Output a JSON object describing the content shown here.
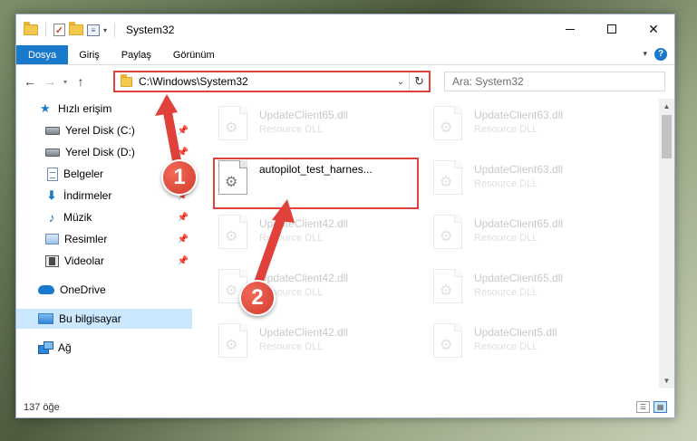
{
  "window": {
    "title": "System32",
    "quick_access_icons": [
      "folder-icon",
      "properties-check-icon",
      "new-folder-icon",
      "customize-icon"
    ]
  },
  "ribbon": {
    "tabs": [
      {
        "label": "Dosya",
        "active": true
      },
      {
        "label": "Giriş"
      },
      {
        "label": "Paylaş"
      },
      {
        "label": "Görünüm"
      }
    ],
    "accent": "#1979ca"
  },
  "address": {
    "path": "C:\\Windows\\System32",
    "search_placeholder": "Ara: System32"
  },
  "nav": {
    "items": [
      {
        "label": "Hızlı erişim",
        "icon": "star-icon"
      },
      {
        "label": "Yerel Disk (C:)",
        "icon": "disk-icon",
        "pinned": true
      },
      {
        "label": "Yerel Disk (D:)",
        "icon": "disk-icon",
        "pinned": true
      },
      {
        "label": "Belgeler",
        "icon": "documents-icon",
        "pinned": true
      },
      {
        "label": "İndirmeler",
        "icon": "downloads-icon",
        "pinned": true
      },
      {
        "label": "Müzik",
        "icon": "music-icon",
        "pinned": true
      },
      {
        "label": "Resimler",
        "icon": "pictures-icon",
        "pinned": true
      },
      {
        "label": "Videolar",
        "icon": "videos-icon",
        "pinned": true
      },
      {
        "label": "OneDrive",
        "icon": "onedrive-icon"
      },
      {
        "label": "Bu bilgisayar",
        "icon": "this-pc-icon",
        "selected": true
      },
      {
        "label": "Ağ",
        "icon": "network-icon"
      }
    ]
  },
  "files": [
    {
      "name": "UpdateClient65.dll",
      "type": "Resource DLL"
    },
    {
      "name": "UpdateClient63.dll",
      "type": "Resource DLL"
    },
    {
      "name": "autopilot_test_harnes...",
      "type": ""
    },
    {
      "name": "UpdateClient63.dll",
      "type": "Resource DLL"
    },
    {
      "name": "UpdateClient42.dll",
      "type": "Resource DLL"
    },
    {
      "name": "UpdateClient65.dll",
      "type": "Resource DLL"
    },
    {
      "name": "UpdateClient42.dll",
      "type": "Resource DLL"
    },
    {
      "name": "UpdateClient65.dll",
      "type": "Resource DLL"
    },
    {
      "name": "UpdateClient42.dll",
      "type": "Resource DLL"
    },
    {
      "name": "UpdateClient5.dll",
      "type": "Resource DLL"
    }
  ],
  "status": {
    "count": "137 öğe"
  },
  "annotations": {
    "step1": "1",
    "step2": "2",
    "color": "#e0413a"
  }
}
